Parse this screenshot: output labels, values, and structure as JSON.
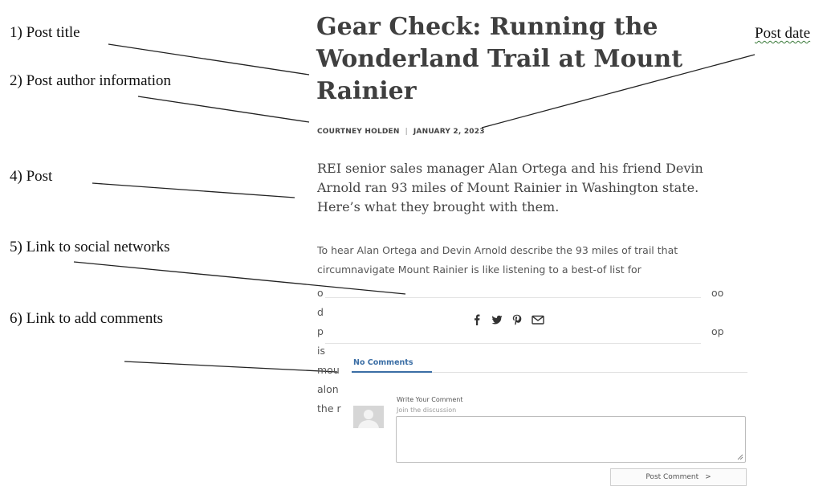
{
  "annotations": {
    "post_title": "1) Post title",
    "author_info": "2) Post author information",
    "post": "4) Post",
    "social": "5) Link to social networks",
    "comments": "6) Link to add comments",
    "post_date": "Post date"
  },
  "article": {
    "title": "Gear Check: Running the Wonderland Trail at Mount Rainier",
    "author": "COURTNEY HOLDEN",
    "separator": "|",
    "date": "JANUARY 2, 2023",
    "lede": "REI senior sales manager Alan Ortega and his friend Devin Arnold ran 93 miles of Mount Rainier in Washington state. Here’s what they brought with them.",
    "body_line1": "To hear Alan Ortega and Devin Arnold describe the 93 miles of trail that",
    "body_line2": "circumnavigate Mount Rainier is like listening to a best-of list for",
    "left_fragments": [
      "o",
      "d",
      "p",
      "is",
      "mou",
      "alon",
      "the r"
    ],
    "right_fragments": [
      "oo",
      "op"
    ]
  },
  "share": {
    "icons": [
      "facebook-icon",
      "twitter-icon",
      "pinterest-icon",
      "email-icon"
    ]
  },
  "comments": {
    "tab_label": "No Comments",
    "write_title": "Write Your Comment",
    "write_subtitle": "Join the discussion",
    "button_label": "Post Comment",
    "button_arrow": ">",
    "accent_color": "#3b6ea5"
  }
}
